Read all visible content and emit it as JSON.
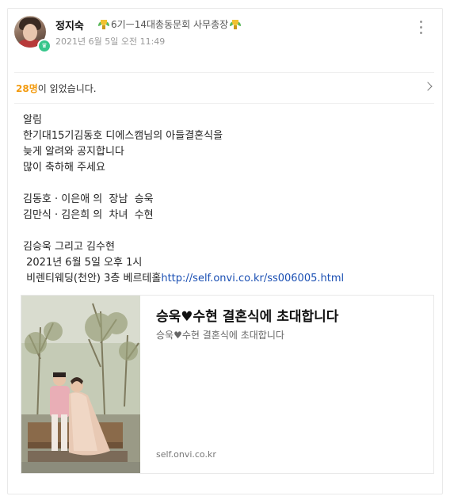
{
  "post": {
    "author_name": "정지숙",
    "author_rank": "6기ㅡ14대총동문회 사무총장",
    "rank_icon": "trophy-icon",
    "date": "2021년 6월 5일 오전 11:49",
    "menu_icon": "more-vert-icon"
  },
  "readers": {
    "count": "28명",
    "suffix": "이 읽었습니다."
  },
  "content": {
    "lines": [
      "알림",
      "한기대15기김동호 디에스캠님의 아들결혼식을",
      "늦게 알려와 공지합니다",
      "많이 축하해 주세요",
      "",
      "김동호 · 이은애 의  장남  승욱",
      "김만식 · 김은희 의  차녀  수현",
      "",
      "김승욱 그리고 김수현",
      " 2021년 6월 5일 오후 1시",
      " 비렌티웨딩(천안) 3층 베르테홀"
    ],
    "link": "http://self.onvi.co.kr/ss006005.html"
  },
  "link_preview": {
    "title": "승욱♥수현 결혼식에 초대합니다",
    "description": "승욱♥수현 결혼식에 초대합니다",
    "domain": "self.onvi.co.kr"
  },
  "colors": {
    "reader_count": "#f39c12",
    "link": "#1a4fb3",
    "online_badge": "#36c68b"
  }
}
